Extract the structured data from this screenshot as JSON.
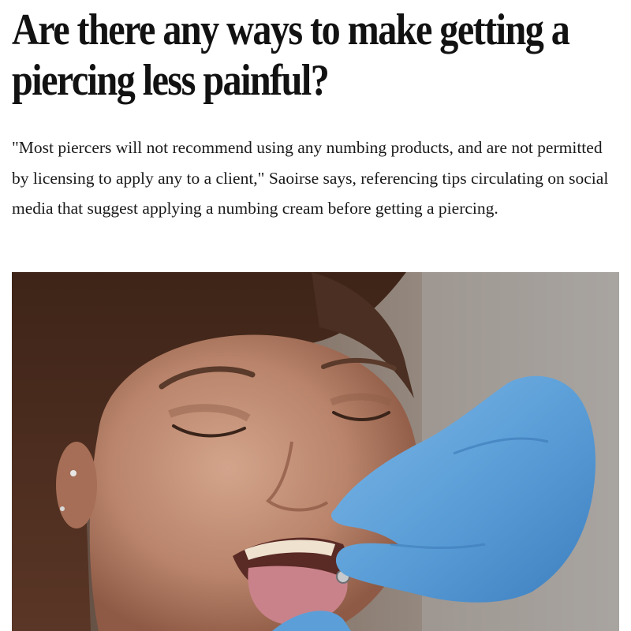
{
  "article": {
    "headline": "Are there any ways to make getting a piercing less painful?",
    "body": "\"Most piercers will not recommend using any numbing products, and are not permitted by licensing to apply any to a client,\" Saoirse says, referencing tips circulating on social media that suggest applying a numbing cream before getting a piercing.",
    "image": {
      "colors": {
        "background": "#8a8580",
        "hair": "#4a2f22",
        "skin": "#c08f78",
        "glove": "#5c9fd8",
        "tongue": "#c9828a"
      }
    }
  }
}
